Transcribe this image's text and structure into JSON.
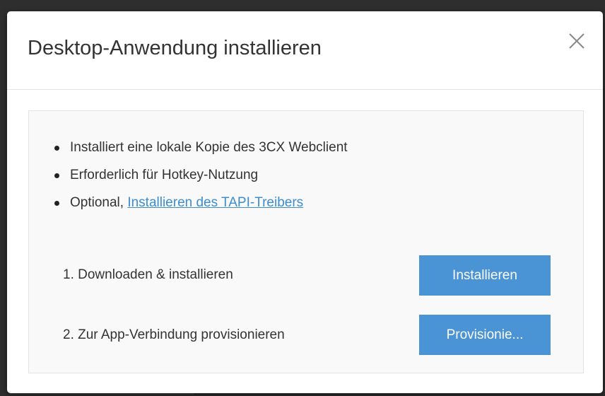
{
  "dialog": {
    "title": "Desktop-Anwendung installieren",
    "close_icon": "close-icon"
  },
  "features": [
    {
      "text": "Installiert eine lokale Kopie des 3CX Webclient"
    },
    {
      "text": "Erforderlich für Hotkey-Nutzung"
    },
    {
      "text_prefix": "Optional, ",
      "link_text": "Installieren des TAPI-Treibers"
    }
  ],
  "steps": [
    {
      "label": "1. Downloaden & installieren",
      "button_label": "Installieren"
    },
    {
      "label": "2. Zur App-Verbindung provisionieren",
      "button_label": "Provisionie..."
    }
  ],
  "colors": {
    "primary_button": "#4a93d4",
    "link": "#3c8dd0",
    "content_background": "#f9f9f9"
  }
}
